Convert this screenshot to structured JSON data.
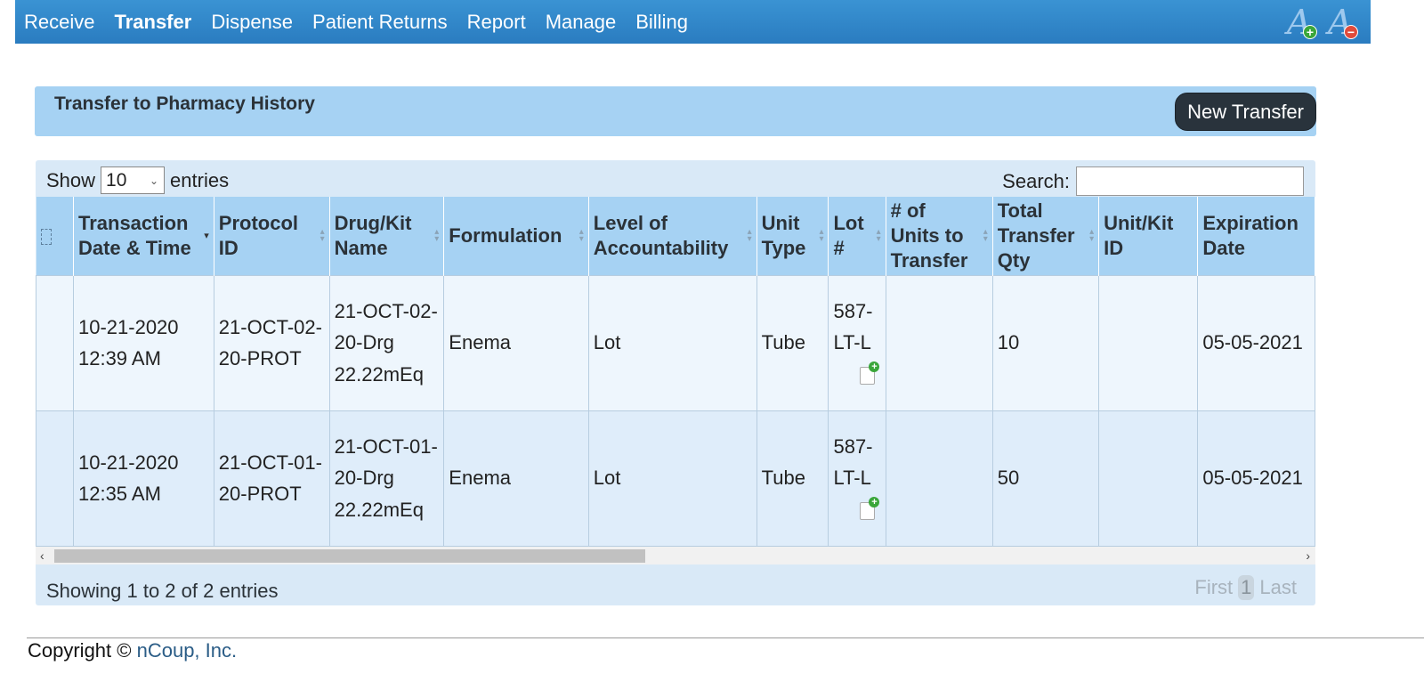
{
  "nav": {
    "items": [
      "Receive",
      "Transfer",
      "Dispense",
      "Patient Returns",
      "Report",
      "Manage",
      "Billing"
    ],
    "active": "Transfer",
    "font_tools": [
      {
        "icon": "font-increase-icon",
        "glyph": "A",
        "badge": "+"
      },
      {
        "icon": "font-decrease-icon",
        "glyph": "A",
        "badge": "−"
      }
    ]
  },
  "panel": {
    "title": "Transfer to Pharmacy History",
    "new_button": "New Transfer"
  },
  "table": {
    "show_label": "Show",
    "entries_label": "entries",
    "page_length": "10",
    "search_label": "Search:",
    "search_value": "",
    "columns": [
      {
        "label": "",
        "icon": "column-visibility-icon"
      },
      {
        "label": "Transaction Date & Time",
        "sort": "desc"
      },
      {
        "label": "Protocol ID",
        "sort": "both"
      },
      {
        "label": "Drug/Kit Name",
        "sort": "both"
      },
      {
        "label": "Formulation",
        "sort": "both"
      },
      {
        "label": "Level of Accountability",
        "sort": "both"
      },
      {
        "label": "Unit Type",
        "sort": "both"
      },
      {
        "label": "Lot #",
        "sort": "both"
      },
      {
        "label": "# of Units to Transfer",
        "sort": "both"
      },
      {
        "label": "Total Transfer Qty",
        "sort": "both"
      },
      {
        "label": "Unit/Kit ID",
        "sort": "none"
      },
      {
        "label": "Expiration Date",
        "sort": "none"
      }
    ],
    "rows": [
      {
        "datetime": "10-21-2020 12:39 AM",
        "protocol_id": "21-OCT-02-20-PROT",
        "drug_name": "21-OCT-02-20-Drg 22.22mEq",
        "formulation": "Enema",
        "accountability": "Lot",
        "unit_type": "Tube",
        "lot": "587-LT-L",
        "units_to_transfer": "",
        "total_qty": "10",
        "unit_kit_id": "",
        "expiration": "05-05-2021"
      },
      {
        "datetime": "10-21-2020 12:35 AM",
        "protocol_id": "21-OCT-01-20-PROT",
        "drug_name": "21-OCT-01-20-Drg 22.22mEq",
        "formulation": "Enema",
        "accountability": "Lot",
        "unit_type": "Tube",
        "lot": "587-LT-L",
        "units_to_transfer": "",
        "total_qty": "50",
        "unit_kit_id": "",
        "expiration": "05-05-2021"
      }
    ],
    "info": "Showing 1 to 2 of 2 entries",
    "pagination": {
      "first": "First",
      "current": "1",
      "last": "Last"
    }
  },
  "footer": {
    "prefix": "Copyright © ",
    "company": "nCoup, Inc."
  }
}
